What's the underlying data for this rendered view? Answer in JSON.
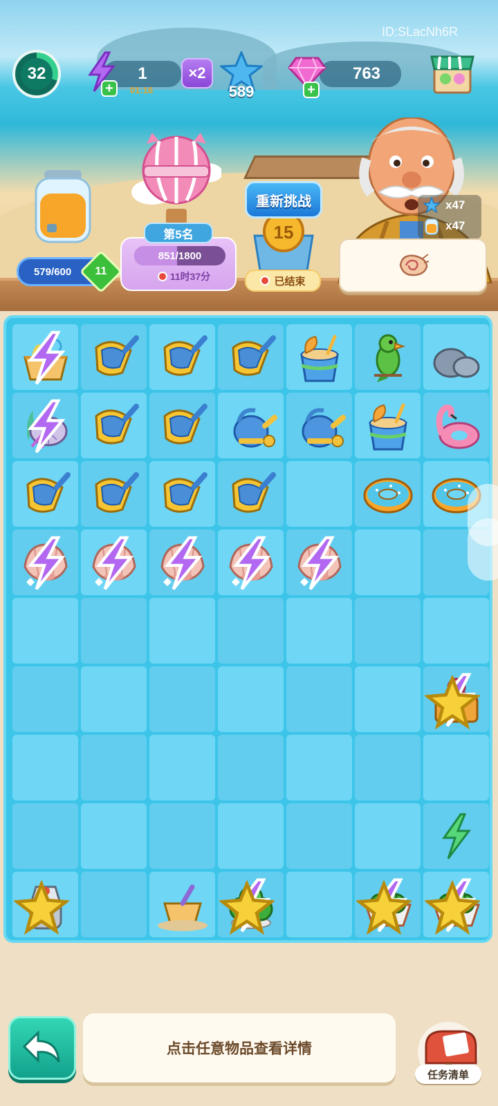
{
  "hud": {
    "player_id": "ID:SLacNh6R",
    "level": "32",
    "energy": "1",
    "energy_timer": "01:16",
    "multiplier": "×2",
    "stars": "589",
    "gems": "763",
    "plus": "+"
  },
  "jar": {
    "progress_text": "579/600",
    "progress_fraction": 0.965,
    "level": "11"
  },
  "event": {
    "rank": "第5名",
    "progress_text": "851/1800",
    "progress_fraction": 0.473,
    "timer": "11时37分",
    "retry_label": "重新挑战",
    "coin_number": "15",
    "ended_label": "已结束"
  },
  "order": {
    "star_count": "x47",
    "juice_count": "x47",
    "item": "conch-shell"
  },
  "board": {
    "columns": 7,
    "rows": 9,
    "cells": [
      [
        "beach-basket",
        "sand-scoop",
        "sand-scoop",
        "sand-scoop",
        "sand-bucket",
        "parrot",
        "rocks"
      ],
      [
        "coral-shell",
        "sand-scoop",
        "sand-scoop",
        "watering-can",
        "watering-can",
        "sand-bucket",
        "flamingo-float"
      ],
      [
        "sand-scoop",
        "sand-scoop",
        "sand-scoop",
        "sand-scoop",
        "",
        "swim-ring",
        "swim-ring"
      ],
      [
        "clam-shell",
        "clam-shell",
        "clam-shell",
        "clam-shell",
        "clam-shell",
        "",
        ""
      ],
      [
        "",
        "",
        "",
        "",
        "",
        "",
        ""
      ],
      [
        "",
        "",
        "",
        "",
        "",
        "",
        "octopus-chest"
      ],
      [
        "",
        "",
        "",
        "",
        "",
        "",
        ""
      ],
      [
        "",
        "",
        "",
        "",
        "",
        "",
        "energy-bolt"
      ],
      [
        "juicer",
        "",
        "sand-basket",
        "cactus-pot",
        "",
        "cactus-tub",
        "cactus-tub"
      ]
    ]
  },
  "bottom": {
    "hint": "点击任意物品查看详情",
    "task_list": "任务清单"
  },
  "colors": {
    "board": "#3cc5e9",
    "cell": "#6fd7f5",
    "accent_green": "#12a28c",
    "hint_text": "#6b4a2a"
  }
}
